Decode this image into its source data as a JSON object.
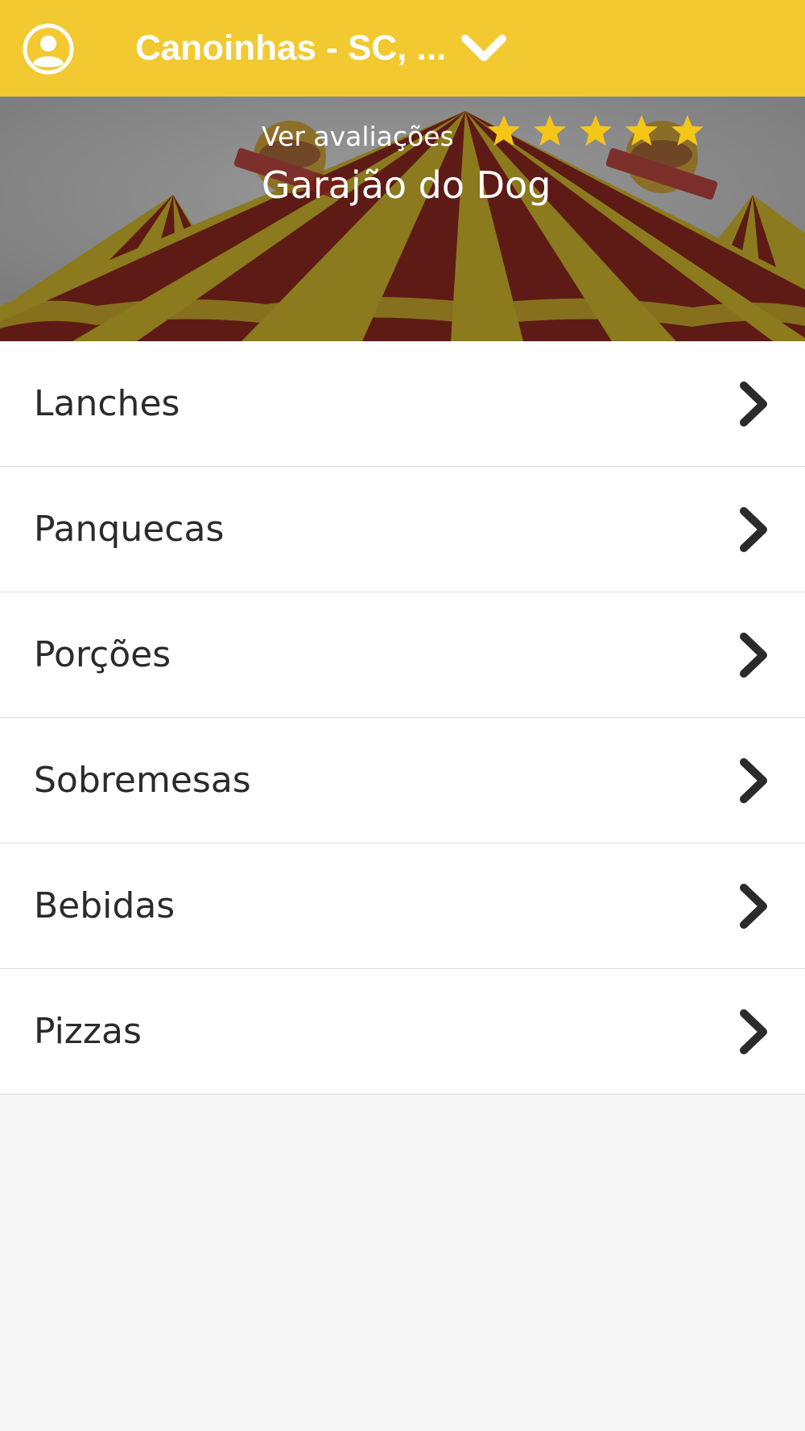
{
  "header": {
    "location": "Canoinhas - SC, ...",
    "avatar_icon": "user-circle-icon",
    "dropdown_icon": "chevron-down-icon",
    "background": "#f2c930"
  },
  "store": {
    "reviews_link": "Ver avaliações",
    "name": "Garajão do Dog",
    "rating": 5,
    "rating_max": 5,
    "star_color": "#f5c518"
  },
  "menu": {
    "items": [
      {
        "label": "Lanches"
      },
      {
        "label": "Panquecas"
      },
      {
        "label": "Porções"
      },
      {
        "label": "Sobremesas"
      },
      {
        "label": "Bebidas"
      },
      {
        "label": "Pizzas"
      }
    ],
    "chevron_icon": "chevron-right-icon"
  }
}
